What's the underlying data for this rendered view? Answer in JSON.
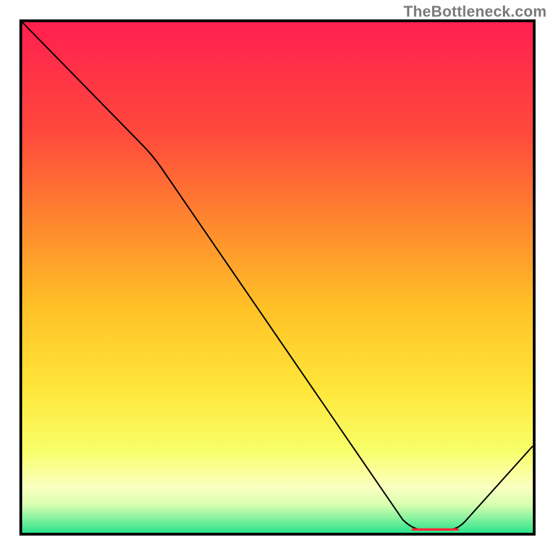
{
  "watermark": {
    "text": "TheBottleneck.com"
  },
  "chart_data": {
    "type": "line",
    "title": "",
    "xlabel": "",
    "ylabel": "",
    "xlim": [
      0,
      100
    ],
    "ylim": [
      0,
      100
    ],
    "grid": false,
    "legend": false,
    "x": [
      0,
      25.5,
      76.5,
      85.3,
      100
    ],
    "series": [
      {
        "name": "curve",
        "values": [
          100,
          74,
          0.6,
          0.6,
          17
        ],
        "color": "#000000"
      }
    ],
    "flat_band": {
      "x_start": 76.5,
      "x_end": 85.3,
      "y": 0.6
    },
    "background": {
      "type": "vertical-gradient",
      "stops": [
        {
          "offset": 0.0,
          "color": "#ff1f4f"
        },
        {
          "offset": 0.22,
          "color": "#ff4a3c"
        },
        {
          "offset": 0.4,
          "color": "#ff8a2e"
        },
        {
          "offset": 0.56,
          "color": "#ffc227"
        },
        {
          "offset": 0.72,
          "color": "#ffe63a"
        },
        {
          "offset": 0.84,
          "color": "#f8ff6a"
        },
        {
          "offset": 0.91,
          "color": "#fbffc0"
        },
        {
          "offset": 0.945,
          "color": "#d8ffb0"
        },
        {
          "offset": 0.97,
          "color": "#8cf3a0"
        },
        {
          "offset": 1.0,
          "color": "#2be38c"
        }
      ]
    }
  },
  "colors": {
    "frame": "#000000",
    "curve": "#000000",
    "flat_marker": "#ff2a3a",
    "watermark": "#7a7a7a"
  }
}
